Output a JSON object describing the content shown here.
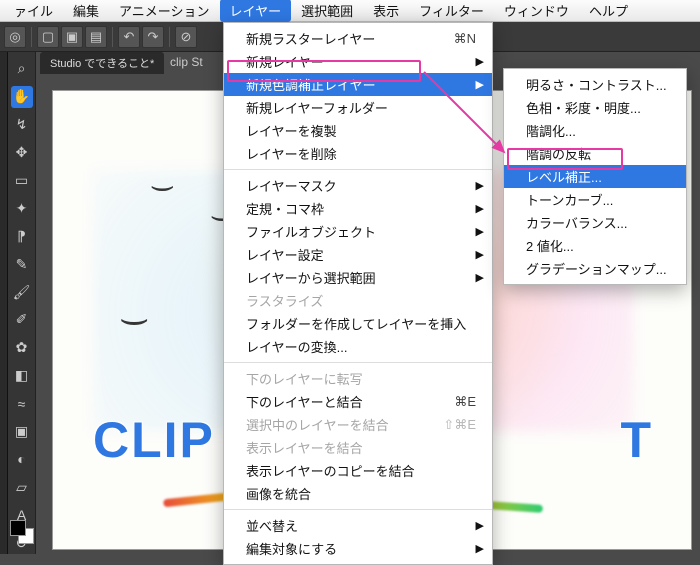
{
  "menubar": {
    "items": [
      "ァイル",
      "編集",
      "アニメーション",
      "レイヤー",
      "選択範囲",
      "表示",
      "フィルター",
      "ウィンドウ",
      "ヘルプ"
    ],
    "active_index": 3
  },
  "app_title": "clip St",
  "tab": {
    "label": "Studio でできること*"
  },
  "canvas_text": {
    "clip": "CLIP",
    "right": "T"
  },
  "layer_menu": [
    {
      "label": "新規ラスターレイヤー",
      "shortcut": "⌘N"
    },
    {
      "label": "新規レイヤー",
      "submenu": true
    },
    {
      "label": "新規色調補正レイヤー",
      "submenu": true,
      "highlight": true
    },
    {
      "label": "新規レイヤーフォルダー"
    },
    {
      "label": "レイヤーを複製"
    },
    {
      "label": "レイヤーを削除"
    },
    {
      "separator": true
    },
    {
      "label": "レイヤーマスク",
      "submenu": true
    },
    {
      "label": "定規・コマ枠",
      "submenu": true
    },
    {
      "label": "ファイルオブジェクト",
      "submenu": true
    },
    {
      "label": "レイヤー設定",
      "submenu": true
    },
    {
      "label": "レイヤーから選択範囲",
      "submenu": true
    },
    {
      "label": "ラスタライズ",
      "disabled": true
    },
    {
      "label": "フォルダーを作成してレイヤーを挿入"
    },
    {
      "label": "レイヤーの変換..."
    },
    {
      "separator": true
    },
    {
      "label": "下のレイヤーに転写",
      "disabled": true
    },
    {
      "label": "下のレイヤーと結合",
      "shortcut": "⌘E"
    },
    {
      "label": "選択中のレイヤーを結合",
      "shortcut": "⇧⌘E",
      "disabled": true
    },
    {
      "label": "表示レイヤーを結合",
      "disabled": true
    },
    {
      "label": "表示レイヤーのコピーを結合"
    },
    {
      "label": "画像を統合"
    },
    {
      "separator": true
    },
    {
      "label": "並べ替え",
      "submenu": true
    },
    {
      "label": "編集対象にする",
      "submenu": true
    }
  ],
  "submenu": [
    {
      "label": "明るさ・コントラスト..."
    },
    {
      "label": "色相・彩度・明度..."
    },
    {
      "label": "階調化..."
    },
    {
      "label": "階調の反転"
    },
    {
      "label": "レベル補正...",
      "highlight": true
    },
    {
      "label": "トーンカーブ..."
    },
    {
      "label": "カラーバランス..."
    },
    {
      "label": "2 値化..."
    },
    {
      "label": "グラデーションマップ..."
    }
  ]
}
